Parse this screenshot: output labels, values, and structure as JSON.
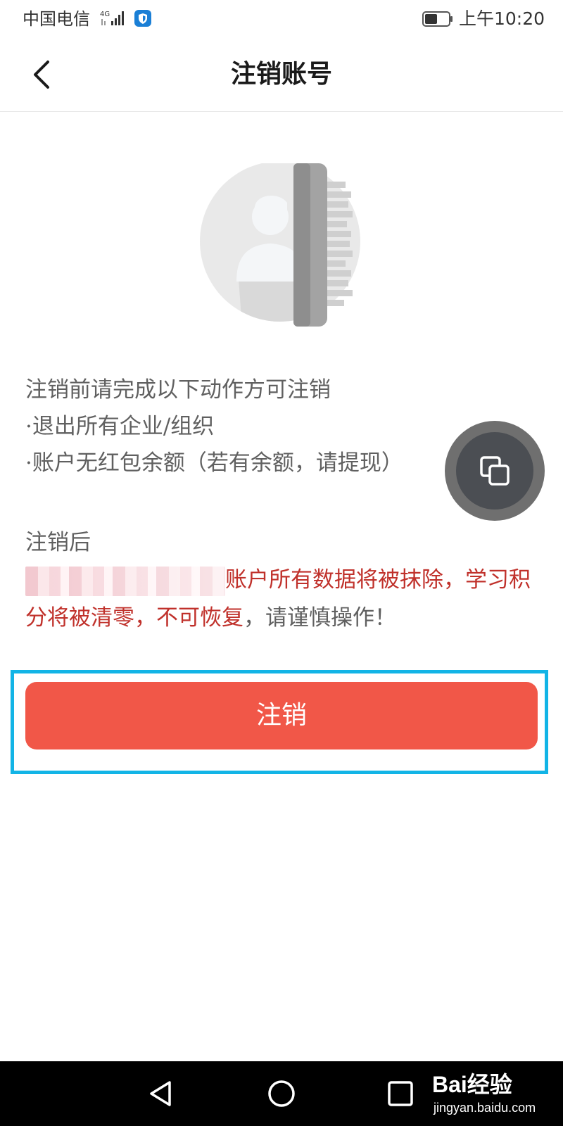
{
  "status_bar": {
    "carrier": "中国电信",
    "network": "4G",
    "time": "上午10:20"
  },
  "header": {
    "title": "注销账号"
  },
  "notice": {
    "intro": "注销前请完成以下动作方可注销",
    "items": [
      "·退出所有企业/组织",
      "·账户无红包余额（若有余额，请提现）"
    ]
  },
  "after": {
    "title": "注销后",
    "warning_red": "账户所有数据将被抹除，学习积分将被清零，不可恢复",
    "warning_normal": "，请谨慎操作！"
  },
  "action": {
    "button_label": "注销",
    "accent_color": "#f15748",
    "highlight_color": "#12b4e6"
  },
  "watermark": {
    "logo_text": "Bai经验",
    "url": "jingyan.baidu.com"
  },
  "icons": {
    "back": "chevron-left-icon",
    "float": "copy-window-icon",
    "nav_back": "triangle-back-icon",
    "nav_home": "circle-home-icon",
    "nav_recent": "square-recent-icon"
  }
}
